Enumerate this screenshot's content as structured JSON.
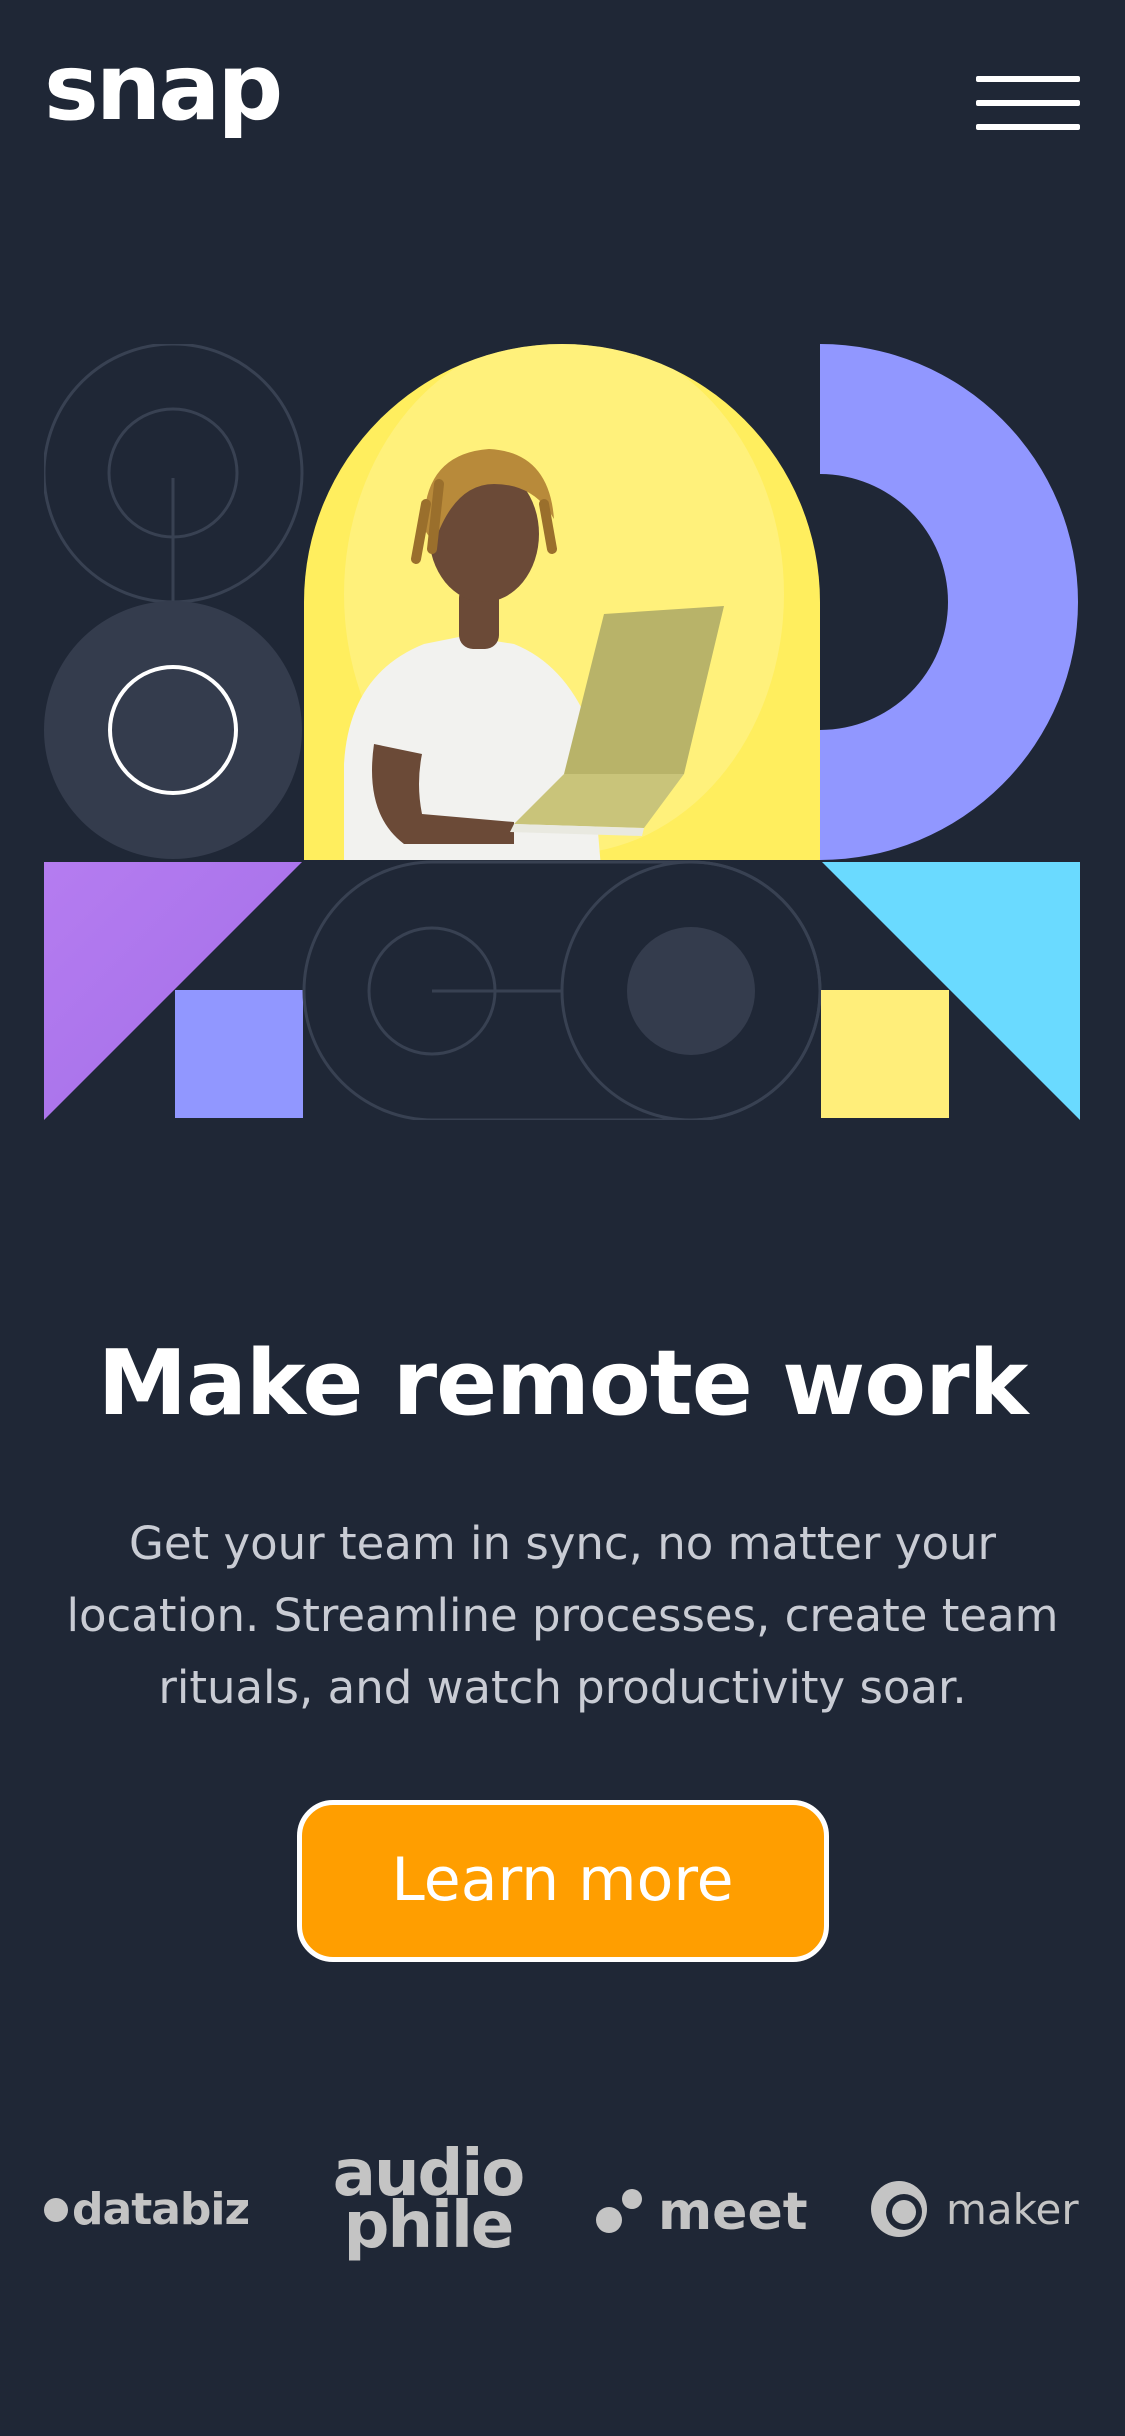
{
  "header": {
    "logo": "snap",
    "menu_icon": "hamburger-menu-icon"
  },
  "hero": {
    "headline": "Make remote work",
    "description": "Get your team in sync, no matter your location. Streamline processes, create team rituals, and watch productivity soar.",
    "cta_label": "Learn more"
  },
  "clients": {
    "databiz": "databiz",
    "audiophile_line1": "audio",
    "audiophile_line2": "phile",
    "meet": "meet",
    "maker": "maker"
  },
  "colors": {
    "background": "#1f2736",
    "accent_orange": "#ff9e00",
    "yellow": "#ffee5e",
    "periwinkle": "#9197ff",
    "violet": "#a872ee",
    "cyan": "#6adaff",
    "muted_text": "#c9ccd4",
    "logo_gray": "#c4c4c4"
  }
}
